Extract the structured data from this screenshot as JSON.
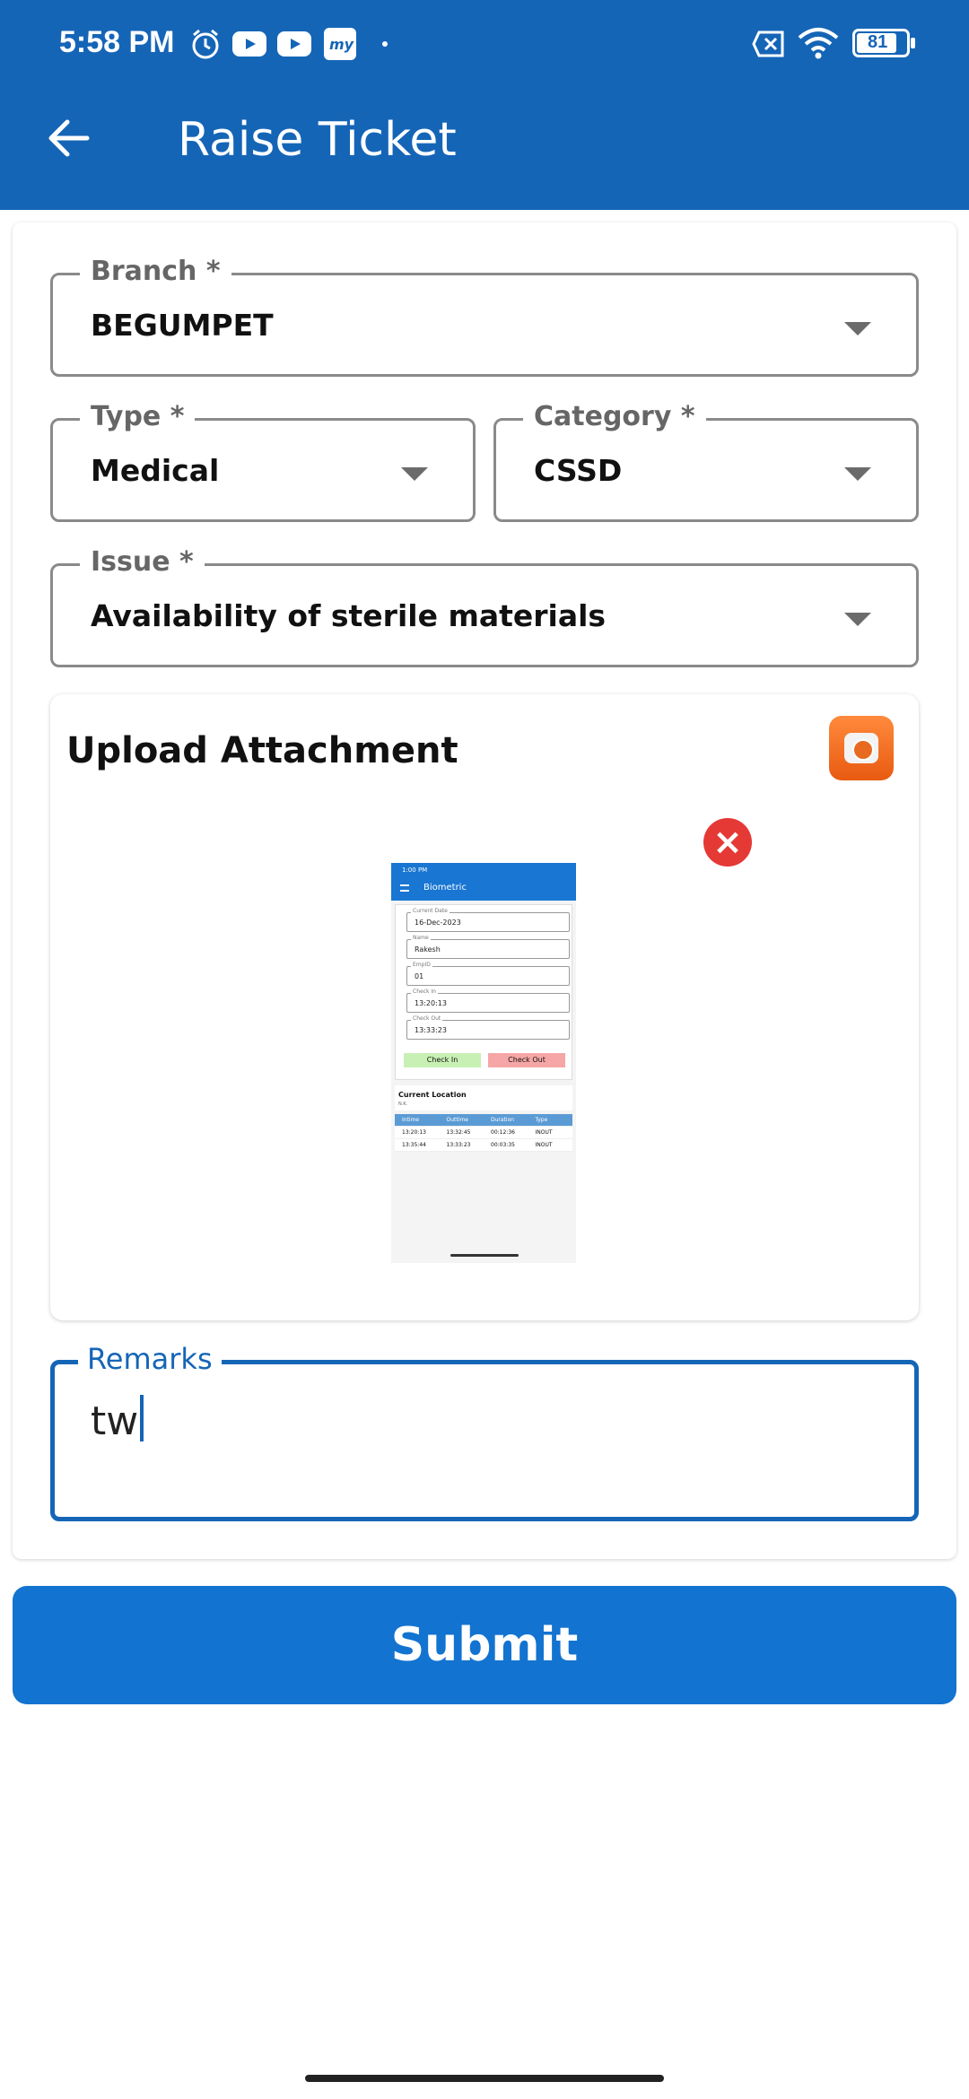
{
  "status_bar": {
    "time": "5:58 PM",
    "battery": "81",
    "icons": [
      "alarm-icon",
      "youtube-icon",
      "youtube-icon",
      "my-app-icon",
      "dot-icon",
      "sim-off-icon",
      "wifi-icon",
      "battery-icon"
    ]
  },
  "app_bar": {
    "title": "Raise Ticket",
    "back_icon": "arrow-left-icon"
  },
  "form": {
    "branch": {
      "label": "Branch *",
      "value": "BEGUMPET"
    },
    "type": {
      "label": "Type *",
      "value": "Medical"
    },
    "category": {
      "label": "Category *",
      "value": "CSSD"
    },
    "issue": {
      "label": "Issue *",
      "value": "Availability of sterile materials"
    },
    "attachment": {
      "title": "Upload Attachment",
      "thumbnail": {
        "status_time": "1:00 PM",
        "title": "Biometric",
        "fields": [
          {
            "label": "Current Date",
            "value": "16-Dec-2023"
          },
          {
            "label": "Name",
            "value": "Rakesh"
          },
          {
            "label": "EmpID",
            "value": "01"
          },
          {
            "label": "Check In",
            "value": "13:20:13"
          },
          {
            "label": "Check Out",
            "value": "13:33:23"
          }
        ],
        "check_in": "Check In",
        "check_out": "Check Out",
        "location_title": "Current Location",
        "location_value": "N.K.",
        "table_headers": [
          "Intime",
          "Outtime",
          "Duration",
          "Type"
        ],
        "table_rows": [
          [
            "13:20:13",
            "13:32:45",
            "00:12:36",
            "INOUT"
          ],
          [
            "13:35:44",
            "13:33:23",
            "00:03:35",
            "INOUT"
          ]
        ]
      }
    },
    "remarks": {
      "label": "Remarks",
      "value": "tw"
    }
  },
  "submit_label": "Submit",
  "colors": {
    "primary": "#1565b7",
    "button": "#1373d0",
    "remove": "#e53935",
    "camera": "#f07a2a"
  }
}
